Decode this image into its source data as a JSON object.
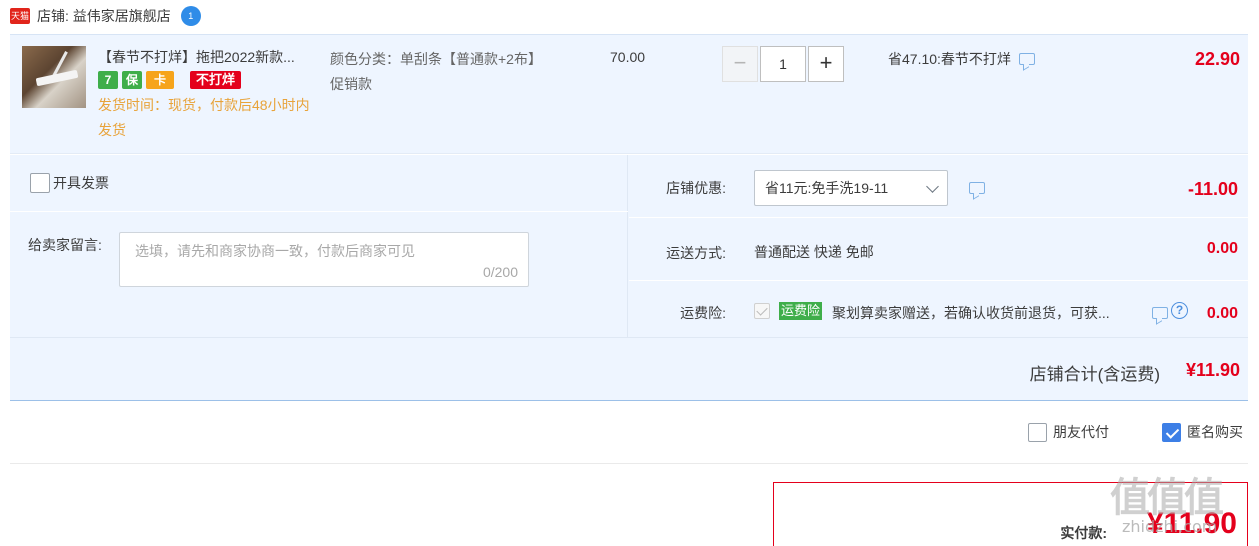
{
  "shop": {
    "badge": "天猫",
    "label": "店铺: 益伟家居旗舰店",
    "chat_icon": "1"
  },
  "item": {
    "title": "【春节不打烊】拖把2022新款...",
    "service_icons": [
      "7",
      "保",
      "卡"
    ],
    "promo_tag": "不打烊",
    "ship_time": "发货时间：现货，付款后48小时内发货",
    "sku": "颜色分类：单刮条【普通款+2布】促销款",
    "unit_price": "70.00",
    "quantity": "1",
    "qty_minus": "−",
    "qty_plus": "+",
    "saving": "省47.10:春节不打烊",
    "subtotal": "22.90"
  },
  "invoice": {
    "label": "开具发票",
    "checked": false
  },
  "message": {
    "label": "给卖家留言:",
    "placeholder": "选填，请先和商家协商一致，付款后商家可见",
    "count": "0/200"
  },
  "coupon": {
    "label": "店铺优惠:",
    "selected": "省11元:免手洗19-11",
    "amount": "-11.00"
  },
  "shipping": {
    "label": "运送方式:",
    "method": "普通配送 快递 免邮",
    "amount": "0.00"
  },
  "insurance": {
    "label": "运费险:",
    "badge": "运费险",
    "text": "聚划算卖家赠送，若确认收货前退货，可获...",
    "help": "?",
    "amount": "0.00"
  },
  "shop_total": {
    "label": "店铺合计(含运费)",
    "value": "¥11.90"
  },
  "pay_options": {
    "friend_label": "朋友代付",
    "friend_checked": false,
    "anonymous_label": "匿名购买",
    "anonymous_checked": true
  },
  "final": {
    "label": "实付款:",
    "value": "¥11.90"
  },
  "watermark": {
    "logo": "值值值",
    "site": "zhidzhi.com"
  },
  "colors": {
    "accent_red": "#e4001c",
    "panel_bg": "#eef5ff",
    "ship_time_orange": "#e8a33a",
    "check_blue": "#3d7fe6"
  }
}
